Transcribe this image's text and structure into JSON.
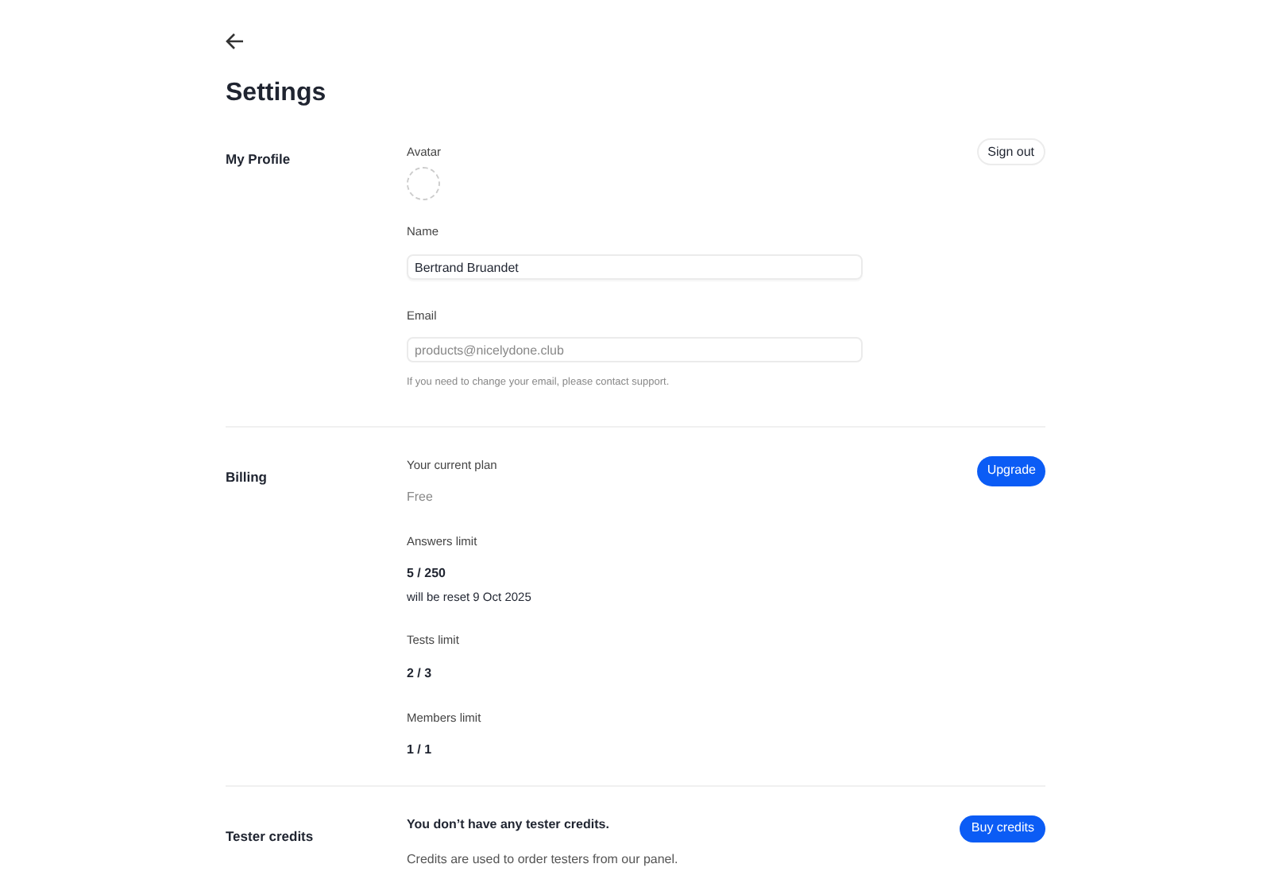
{
  "title": "Settings",
  "profile": {
    "heading": "My Profile",
    "sign_out": "Sign out",
    "avatar_label": "Avatar",
    "fields": [
      {
        "label": "Name",
        "value": "Bertrand Bruandet",
        "disabled": false
      },
      {
        "label": "Email",
        "value": "products@nicelydone.club",
        "disabled": true,
        "hint": "If you need to change your email, please contact support."
      }
    ]
  },
  "billing": {
    "heading": "Billing",
    "upgrade": "Upgrade",
    "items": [
      {
        "kind": "plan",
        "label": "Your current plan",
        "value": "Free"
      },
      {
        "kind": "limit",
        "label": "Answers limit",
        "value": "5 / 250",
        "note": "will be reset 9 Oct 2025"
      },
      {
        "kind": "limit",
        "label": "Tests limit",
        "value": "2 / 3"
      },
      {
        "kind": "limit",
        "label": "Members limit",
        "value": "1 / 1"
      }
    ]
  },
  "credits": {
    "heading": "Tester credits",
    "message": "You don’t have any tester credits.",
    "description": "Credits are used to order testers from our panel.",
    "button": "Buy credits"
  }
}
